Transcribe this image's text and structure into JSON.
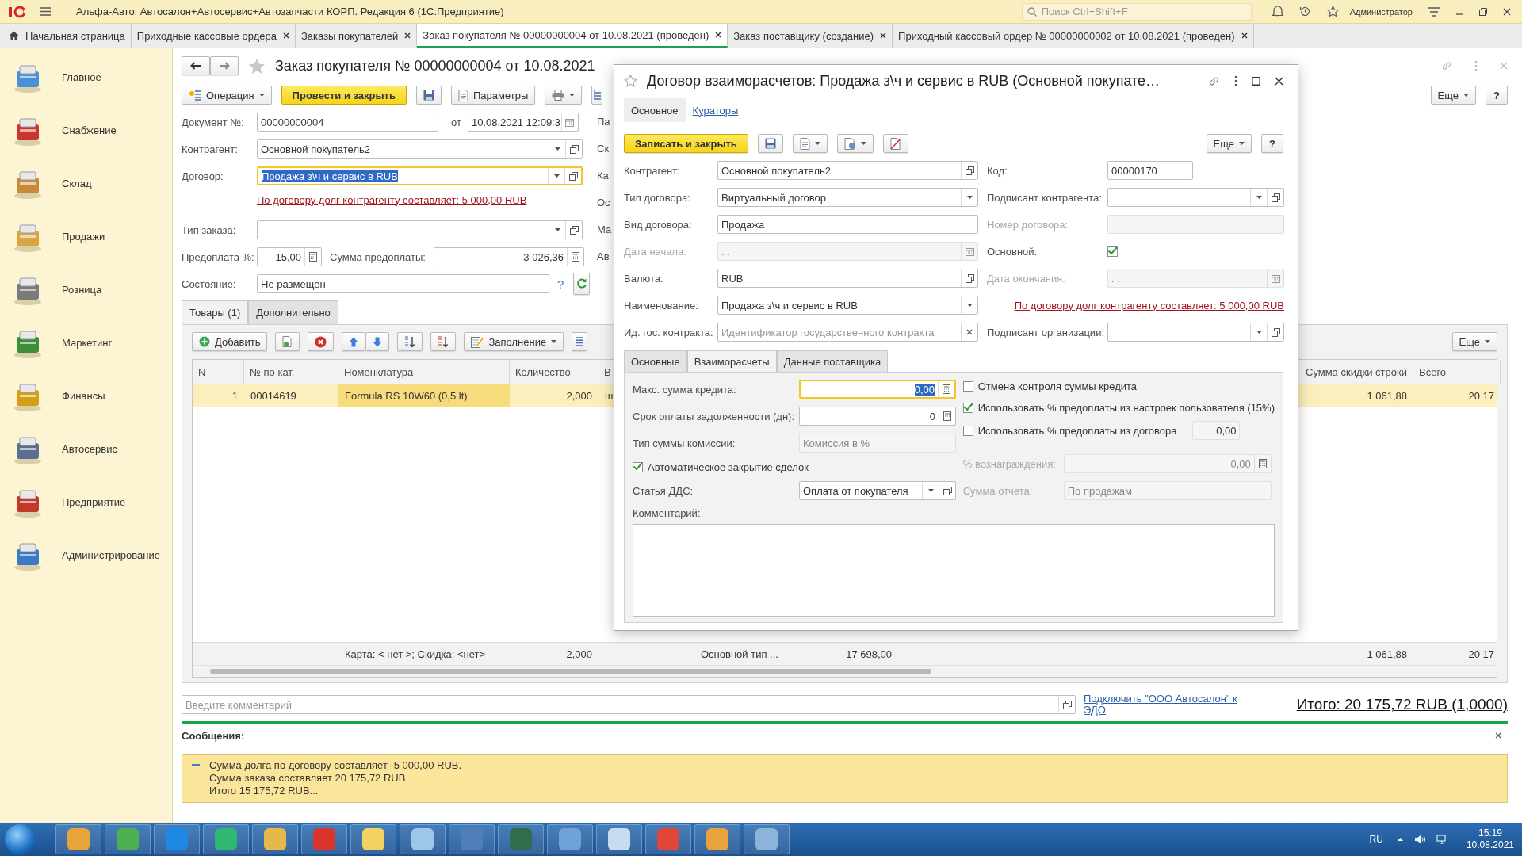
{
  "app": {
    "title": "Альфа-Авто: Автосалон+Автосервис+Автозапчасти КОРП. Редакция 6  (1С:Предприятие)",
    "search": {
      "placeholder": "Поиск Ctrl+Shift+F"
    },
    "user": "Администратор"
  },
  "tabs": [
    {
      "label": "Начальная страница",
      "selected": false,
      "kind": "home"
    },
    {
      "label": "Приходные кассовые ордера",
      "selected": false,
      "kind": "doc"
    },
    {
      "label": "Заказы покупателей",
      "selected": false,
      "kind": "doc"
    },
    {
      "label": "Заказ покупателя № 00000000004 от 10.08.2021 (проведен)",
      "selected": true,
      "kind": "doc"
    },
    {
      "label": "Заказ поставщику (создание)",
      "selected": false,
      "kind": "doc"
    },
    {
      "label": "Приходный кассовый ордер № 00000000002 от 10.08.2021 (проведен)",
      "selected": false,
      "kind": "doc"
    }
  ],
  "sidebar": {
    "items": [
      {
        "label": "Главное"
      },
      {
        "label": "Снабжение"
      },
      {
        "label": "Склад"
      },
      {
        "label": "Продажи"
      },
      {
        "label": "Розница"
      },
      {
        "label": "Маркетинг"
      },
      {
        "label": "Финансы"
      },
      {
        "label": "Автосервис"
      },
      {
        "label": "Предприятие"
      },
      {
        "label": "Администрирование"
      }
    ]
  },
  "form": {
    "title": "Заказ покупателя № 00000000004 от 10.08.2021",
    "toolbar": {
      "operation": "Операция",
      "post_close": "Провести и закрыть",
      "parameters": "Параметры",
      "more": "Еще",
      "help": "?"
    },
    "document_number": {
      "label": "Документ №:",
      "value": "00000000004"
    },
    "date": {
      "label": "от",
      "value": "10.08.2021 12:09:3"
    },
    "counterparty": {
      "label": "Контрагент:",
      "value": "Основной покупатель2",
      "focused": false
    },
    "contract": {
      "label": "Договор:",
      "value": "Продажа з\\ч и сервис в RUB",
      "focused": true
    },
    "debt_link": "По договору долг контрагенту составляет: 5 000,00 RUB",
    "order_type": {
      "label": "Тип заказа:",
      "focused": false
    },
    "prepayment_percent": {
      "label": "Предоплата %:",
      "value": "15,00"
    },
    "prepayment_sum": {
      "label": "Сумма предоплаты:",
      "value": "3 026,36"
    },
    "state": {
      "label": "Состояние:",
      "value": "Не размещен",
      "help": "?"
    },
    "cut_labels": [
      "Па",
      "Ск",
      "Ка",
      "Ос",
      "Ма",
      "Ав"
    ],
    "sections": [
      {
        "label": "Товары (1)",
        "selected": true
      },
      {
        "label": "Дополнительно",
        "selected": false
      }
    ],
    "table_toolbar": {
      "add": "Добавить",
      "fill": "Заполнение",
      "more": "Еще"
    },
    "table": {
      "columns": [
        "N",
        "№ по кат.",
        "Номенклатура",
        "Количество",
        "В",
        "Сумма скидки строки",
        "Всего"
      ],
      "rows": [
        {
          "selected": true,
          "cells": [
            "1",
            "00014619",
            "Formula RS 10W60 (0,5 lt)",
            "2,000",
            "ш",
            "1 061,88",
            "20 17"
          ]
        }
      ],
      "footer": {
        "card_discount": "Карта: < нет >; Скидка: <нет>",
        "quantity": "2,000",
        "column_6": "Основной тип ...",
        "column_7": "17 698,00",
        "discount": "1 061,88",
        "total": "20 17"
      }
    },
    "comment": {
      "placeholder": "Введите комментарий"
    },
    "edo_link": "Подключить \"ООО Автосалон\" к ЭДО",
    "total": "Итого: 20 175,72 RUB (1,0000)"
  },
  "messages": {
    "title": "Сообщения:",
    "lines": [
      "Сумма долга по договору составляет -5 000,00 RUB.",
      "Сумма заказа составляет 20 175,72 RUB",
      "Итого 15 175,72 RUB..."
    ]
  },
  "dialog": {
    "title": "Договор взаиморасчетов: Продажа з\\ч и сервис в RUB (Основной покупате…",
    "tabs": [
      {
        "label": "Основное",
        "selected": true
      },
      {
        "label": "Кураторы",
        "selected": false
      }
    ],
    "toolbar": {
      "save_close": "Записать и закрыть",
      "more": "Еще",
      "help": "?"
    },
    "left_fields": [
      {
        "kind": "ref",
        "label": "Контрагент:",
        "value": "Основной покупатель2",
        "disabled": false
      },
      {
        "kind": "select",
        "label": "Тип договора:",
        "value": "Виртуальный договор",
        "disabled": false
      },
      {
        "kind": "text",
        "label": "Вид договора:",
        "value": "Продажа",
        "disabled": false
      },
      {
        "kind": "date",
        "label": "Дата начала:",
        "value": ".  .",
        "disabled": true
      },
      {
        "kind": "ref",
        "label": "Валюта:",
        "value": "RUB",
        "disabled": false
      },
      {
        "kind": "select",
        "label": "Наименование:",
        "value": "Продажа з\\ч и сервис в RUB",
        "disabled": false
      },
      {
        "kind": "clearable",
        "label": "Ид. гос. контракта:",
        "placeholder": "Идентификатор государственного контракта",
        "disabled": false
      }
    ],
    "right_fields": [
      {
        "kind": "code",
        "label": "Код:",
        "value": "00000170",
        "disabled": false
      },
      {
        "kind": "select_ref",
        "label": "Подписант контрагента:",
        "disabled": false
      },
      {
        "kind": "text",
        "label": "Номер договора:",
        "disabled": true
      },
      {
        "kind": "checkbox",
        "label": "Основной:",
        "checked": true
      },
      {
        "kind": "date",
        "label": "Дата окончания:",
        "value": ".  .",
        "disabled": true
      },
      {
        "kind": "link",
        "text": "По договору долг контрагенту составляет: 5 000,00 RUB"
      },
      {
        "kind": "select_ref",
        "label": "Подписант организации:",
        "disabled": false
      }
    ],
    "inner_tabs": [
      {
        "label": "Основные",
        "selected": false
      },
      {
        "label": "Взаиморасчеты",
        "selected": true
      },
      {
        "label": "Данные поставщика",
        "selected": false
      }
    ],
    "credit_left": [
      {
        "kind": "number",
        "label": "Макс. сумма кредита:",
        "value": "0,00",
        "focused": true,
        "disabled": false
      },
      {
        "kind": "number",
        "label": "Срок оплаты задолженности (дн):",
        "value": "0",
        "focused": false,
        "disabled": false
      },
      {
        "kind": "text",
        "label": "Тип суммы комиссии:",
        "value": "Комиссия в %",
        "focused": false,
        "disabled": true
      },
      {
        "kind": "checkbox",
        "label": "Автоматическое закрытие сделок",
        "checked": true
      },
      {
        "kind": "select_ref",
        "label": "Статья ДДС:",
        "value": "Оплата от покупателя",
        "focused": false,
        "disabled": false
      }
    ],
    "credit_right": [
      {
        "kind": "checkbox",
        "label": "Отмена контроля суммы кредита",
        "checked": false
      },
      {
        "kind": "checkbox",
        "label": "Использовать % предоплаты из настроек пользователя (15%)",
        "checked": true
      },
      {
        "kind": "checkbox_field",
        "label": "Использовать % предоплаты из договора",
        "checked": false,
        "value": "0,00"
      },
      {
        "kind": "number",
        "label": "%  вознаграждения:",
        "value": "0,00",
        "disabled": true
      },
      {
        "kind": "text",
        "label": "Сумма отчета:",
        "value": "По продажам",
        "disabled": true
      }
    ],
    "comment_label": "Комментарий:"
  },
  "taskbar": {
    "language": "RU",
    "time": "15:19",
    "date": "10.08.2021"
  }
}
